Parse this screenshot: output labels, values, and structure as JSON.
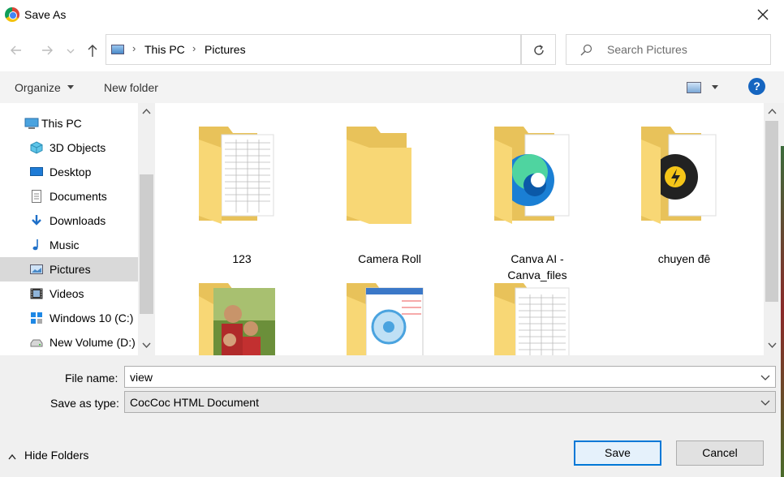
{
  "window": {
    "title": "Save As",
    "app_icon": "chrome-icon"
  },
  "address": {
    "breadcrumbs": [
      "This PC",
      "Pictures"
    ],
    "search_placeholder": "Search Pictures"
  },
  "toolbar": {
    "organize_label": "Organize",
    "new_folder_label": "New folder",
    "help_label": "?"
  },
  "nav": {
    "items": [
      {
        "label": "This PC",
        "icon": "computer-icon"
      },
      {
        "label": "3D Objects",
        "icon": "3d-objects-icon"
      },
      {
        "label": "Desktop",
        "icon": "desktop-icon"
      },
      {
        "label": "Documents",
        "icon": "documents-icon"
      },
      {
        "label": "Downloads",
        "icon": "downloads-icon"
      },
      {
        "label": "Music",
        "icon": "music-icon"
      },
      {
        "label": "Pictures",
        "icon": "pictures-icon",
        "selected": true
      },
      {
        "label": "Videos",
        "icon": "videos-icon"
      },
      {
        "label": "Windows 10 (C:)",
        "icon": "windows-drive-icon"
      },
      {
        "label": "New Volume (D:)",
        "icon": "drive-icon"
      }
    ]
  },
  "folders": [
    {
      "name": "123"
    },
    {
      "name": "Camera Roll"
    },
    {
      "name": "Canva AI -\nCanva_files"
    },
    {
      "name": "chuyen đê"
    },
    {
      "name": ""
    },
    {
      "name": ""
    },
    {
      "name": ""
    }
  ],
  "form": {
    "file_name_label": "File name:",
    "file_name_value": "view",
    "save_type_label": "Save as type:",
    "save_type_value": "CocCoc HTML Document"
  },
  "footer": {
    "hide_folders_label": "Hide Folders",
    "save_label": "Save",
    "cancel_label": "Cancel"
  },
  "colors": {
    "accent": "#0078d7",
    "folder": "#f8d775",
    "selected_nav": "#d9d9d9"
  }
}
